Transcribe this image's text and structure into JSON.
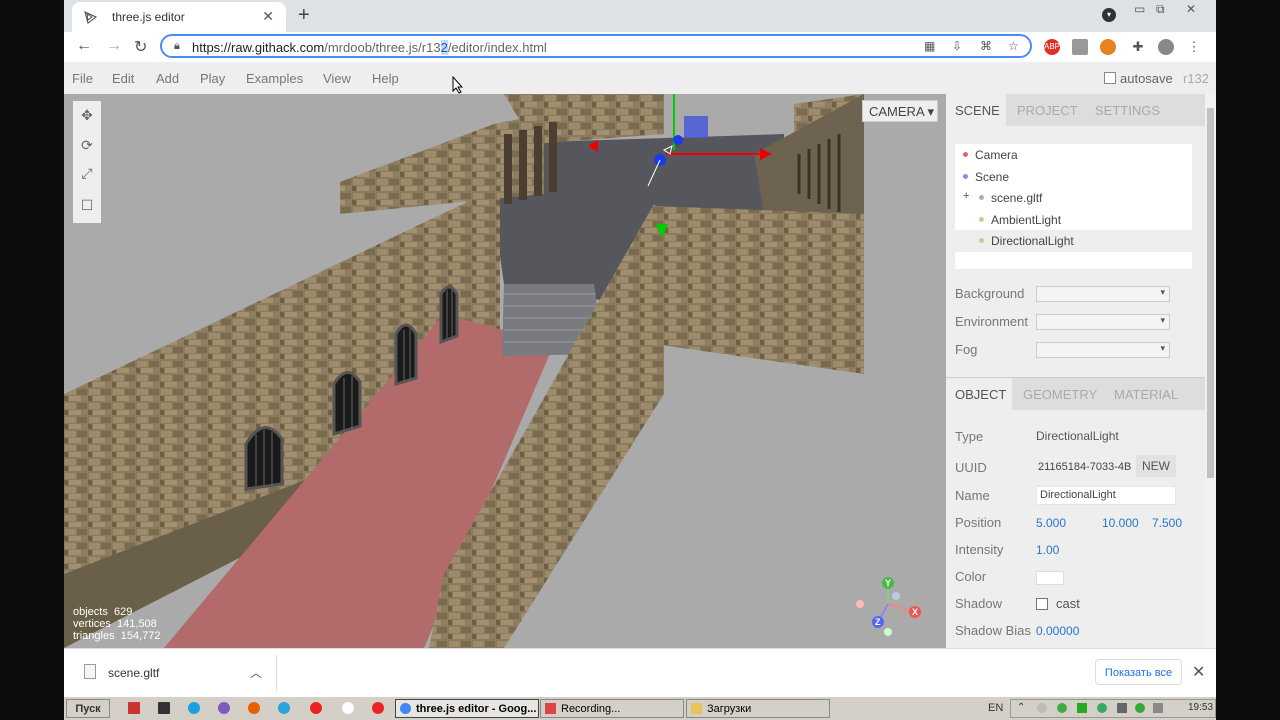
{
  "browser": {
    "tab_title": "three.js editor",
    "url_host": "https://raw.githack.com",
    "url_path_before": "/mrdoob/three.js/r13",
    "url_path_selected": "2",
    "url_path_after": "/editor/index.html"
  },
  "menubar": {
    "items": [
      "File",
      "Edit",
      "Add",
      "Play",
      "Examples",
      "View",
      "Help"
    ],
    "autosave_label": "autosave",
    "version": "r132"
  },
  "viewport": {
    "camera_select": "CAMERA",
    "info": {
      "objects_label": "objects",
      "objects": "629",
      "vertices_label": "vertices",
      "vertices": "141,508",
      "triangles_label": "triangles",
      "triangles": "154,772"
    },
    "gizmo": {
      "y": "Y",
      "x": "X",
      "z": "Z"
    }
  },
  "sidebar": {
    "tabs": [
      "SCENE",
      "PROJECT",
      "SETTINGS"
    ],
    "outliner": [
      {
        "label": "Camera",
        "color": "#d66"
      },
      {
        "label": "Scene",
        "color": "#88f"
      },
      {
        "label": "scene.gltf",
        "color": "#aac",
        "expander": "+"
      },
      {
        "label": "AmbientLight",
        "color": "#cc8"
      },
      {
        "label": "DirectionalLight",
        "color": "#cc8"
      }
    ],
    "background_label": "Background",
    "environment_label": "Environment",
    "fog_label": "Fog",
    "object_tabs": [
      "OBJECT",
      "GEOMETRY",
      "MATERIAL"
    ],
    "object": {
      "type_label": "Type",
      "type": "DirectionalLight",
      "uuid_label": "UUID",
      "uuid": "21165184-7033-4B",
      "new_label": "NEW",
      "name_label": "Name",
      "name": "DirectionalLight",
      "position_label": "Position",
      "position": [
        "5.000",
        "10.000",
        "7.500"
      ],
      "intensity_label": "Intensity",
      "intensity": "1.00",
      "color_label": "Color",
      "shadow_label": "Shadow",
      "shadow_cast": "cast",
      "shadow_bias_label": "Shadow Bias",
      "shadow_bias": "0.00000"
    }
  },
  "download": {
    "file": "scene.gltf",
    "show_all": "Показать все"
  },
  "taskbar": {
    "start": "Пуск",
    "tasks": [
      "three.js editor - Goog...",
      "Recording...",
      "Загрузки"
    ],
    "lang": "EN",
    "clock": "19:53"
  }
}
